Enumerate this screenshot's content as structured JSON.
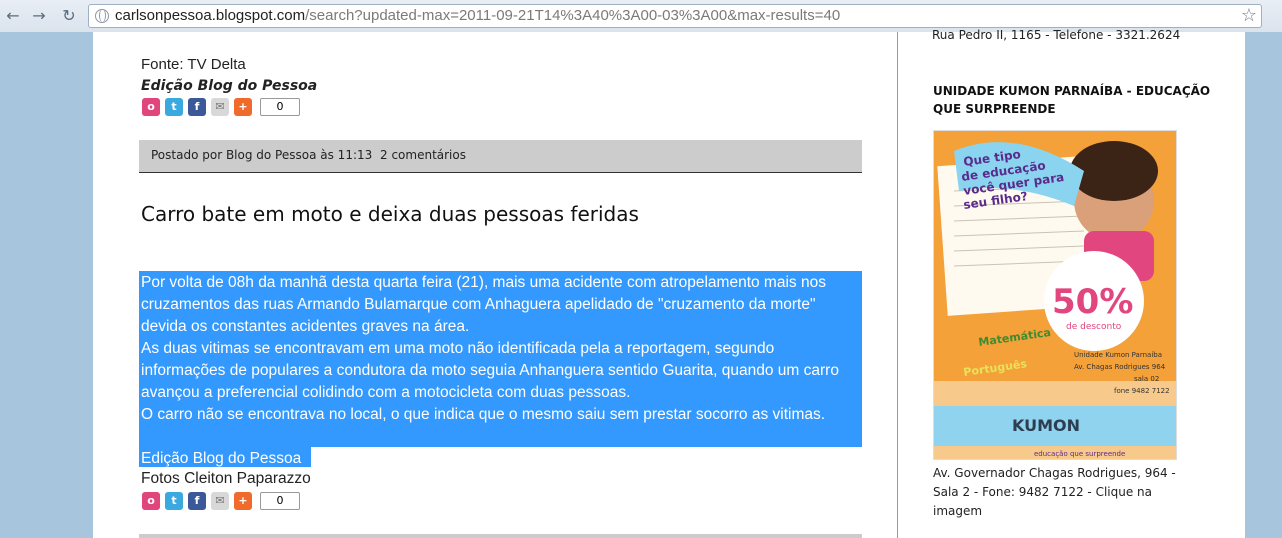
{
  "browser": {
    "url_host": "carlsonpessoa.blogspot.com",
    "url_path": "/search?updated-max=2011-09-21T14%3A40%3A00-03%3A00&max-results=40"
  },
  "prev_post": {
    "source": "Fonte: TV Delta",
    "edited_by": "Edição Blog do Pessoa",
    "share_count": "0"
  },
  "post_footer": {
    "posted_by": "Postado por Blog do Pessoa às 11:13",
    "comments": "2 comentários"
  },
  "post": {
    "title": "Carro bate em moto e deixa duas pessoas feridas",
    "lines": [
      "Por volta de 08h da manhã desta quarta feira (21), mais uma acidente com atropelamento mais  nos",
      "cruzamentos das ruas Armando Bulamarque com Anhaguera apelidado de \"cruzamento da morte\"",
      "devida os constantes acidentes graves na área.",
      "As duas vitimas se encontravam em uma moto não identificada pela a reportagem, segundo",
      "informações de populares a condutora da moto seguia Anhanguera sentido Guarita, quando um carro",
      "avançou a preferencial colidindo com a motocicleta com duas pessoas.",
      "O carro não se encontrava no local, o que indica que o mesmo saiu sem prestar socorro as vitimas.",
      "",
      "Edição Blog do Pessoa"
    ],
    "photos": "Fotos Cleiton Paparazzo",
    "share_count": "0"
  },
  "sidebar": {
    "top_address": "Rua Pedro II, 1165 - Telefone - 3321.2624",
    "kumon_heading": "UNIDADE KUMON PARNAÍBA - EDUCAÇÃO QUE SURPREENDE",
    "ad": {
      "headline": "Que tipo de educação você quer para seu filho?",
      "discount": "50%",
      "discount_sub": "de desconto",
      "math": "Matemática",
      "port": "Português",
      "unit": "Unidade Kumon Parnaíba",
      "street": "Av. Chagas Rodrigues 964",
      "room": "sala 02",
      "phone": "fone 9482 7122",
      "brand": "KUMON",
      "tagline": "educação que surpreende"
    },
    "kumon_caption": "Av. Governador Chagas Rodrigues, 964 - Sala 2 - Fone: 9482 7122 - Clique na imagem"
  },
  "colors": {
    "selection": "#3399ff",
    "footer_bar": "#cccccc",
    "page_bg": "#a7c6de"
  }
}
